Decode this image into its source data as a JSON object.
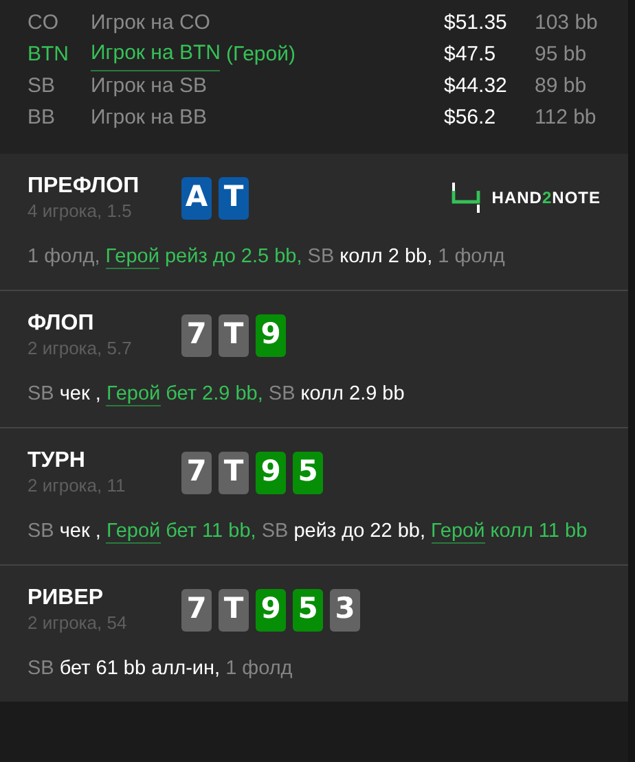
{
  "players": [
    {
      "position": "CO",
      "name": "Игрок на CO",
      "hero": false,
      "stack": "$51.35",
      "bb": "103 bb"
    },
    {
      "position": "BTN",
      "name": "Игрок на BTN",
      "hero": true,
      "tag": "(Герой)",
      "stack": "$47.5",
      "bb": "95 bb"
    },
    {
      "position": "SB",
      "name": "Игрок на SB",
      "hero": false,
      "stack": "$44.32",
      "bb": "89 bb"
    },
    {
      "position": "BB",
      "name": "Игрок на BB",
      "hero": false,
      "stack": "$56.2",
      "bb": "112 bb"
    }
  ],
  "streets": [
    {
      "name": "ПРЕФЛОП",
      "info": "4 игрока, 1.5",
      "cards": [
        {
          "rank": "A",
          "color": "#0b5aa8"
        },
        {
          "rank": "T",
          "color": "#0b5aa8"
        }
      ],
      "logo": [
        {
          "text": "HAND",
          "kind": "plain"
        },
        {
          "text": "2",
          "kind": "accent"
        },
        {
          "text": "NOTE",
          "kind": "plain"
        }
      ],
      "actions": [
        {
          "text": "1 фолд, ",
          "kind": "muted"
        },
        {
          "text": "Герой",
          "kind": "hero_link"
        },
        {
          "text": " рейз до 2.5 bb, ",
          "kind": "hero"
        },
        {
          "text": "SB ",
          "kind": "muted"
        },
        {
          "text": "колл 2 bb, ",
          "kind": "plain"
        },
        {
          "text": "1 фолд",
          "kind": "muted"
        }
      ]
    },
    {
      "name": "ФЛОП",
      "info": "2 игрока, 5.7",
      "cards": [
        {
          "rank": "7",
          "color": "#636363"
        },
        {
          "rank": "T",
          "color": "#636363"
        },
        {
          "rank": "9",
          "color": "#078e07"
        }
      ],
      "actions": [
        {
          "text": "SB ",
          "kind": "muted"
        },
        {
          "text": "чек , ",
          "kind": "plain"
        },
        {
          "text": "Герой",
          "kind": "hero_link"
        },
        {
          "text": " бет 2.9 bb, ",
          "kind": "hero"
        },
        {
          "text": "SB ",
          "kind": "muted"
        },
        {
          "text": "колл 2.9 bb",
          "kind": "plain"
        }
      ]
    },
    {
      "name": "ТУРН",
      "info": "2 игрока, 11",
      "cards": [
        {
          "rank": "7",
          "color": "#636363"
        },
        {
          "rank": "T",
          "color": "#636363"
        },
        {
          "rank": "9",
          "color": "#078e07"
        },
        {
          "rank": "5",
          "color": "#078e07"
        }
      ],
      "actions": [
        {
          "text": "SB ",
          "kind": "muted"
        },
        {
          "text": "чек , ",
          "kind": "plain"
        },
        {
          "text": "Герой",
          "kind": "hero_link"
        },
        {
          "text": " бет 11 bb, ",
          "kind": "hero"
        },
        {
          "text": "SB ",
          "kind": "muted"
        },
        {
          "text": "рейз до 22 bb, ",
          "kind": "plain"
        },
        {
          "text": "Герой",
          "kind": "hero_link"
        },
        {
          "text": " колл 11 bb",
          "kind": "hero"
        }
      ]
    },
    {
      "name": "РИВЕР",
      "info": "2 игрока, 54",
      "cards": [
        {
          "rank": "7",
          "color": "#636363"
        },
        {
          "rank": "T",
          "color": "#636363"
        },
        {
          "rank": "9",
          "color": "#078e07"
        },
        {
          "rank": "5",
          "color": "#078e07"
        },
        {
          "rank": "3",
          "color": "#636363"
        }
      ],
      "actions": [
        {
          "text": "SB ",
          "kind": "muted"
        },
        {
          "text": "бет 61 bb алл-ин, ",
          "kind": "plain"
        },
        {
          "text": "1 фолд",
          "kind": "muted"
        }
      ]
    }
  ]
}
